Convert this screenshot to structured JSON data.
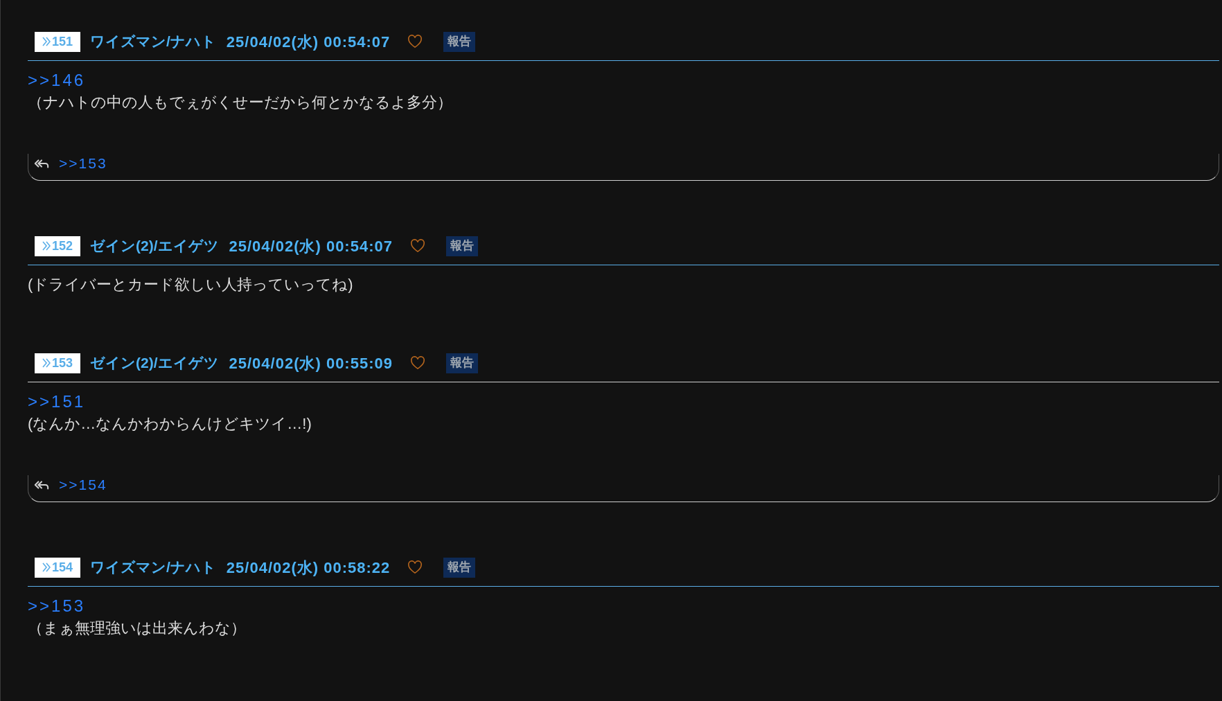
{
  "posts": [
    {
      "number": "151",
      "name": "ワイズマン/ナハト",
      "date": "25/04/02(水) 00:54:07",
      "report": "報告",
      "color": "#5aaee8",
      "anchor": ">>146",
      "body": "（ナハトの中の人もでぇがくせーだから何とかなるよ多分）",
      "replies": [
        ">>153"
      ]
    },
    {
      "number": "152",
      "name": "ゼイン(2)/エイゲツ",
      "date": "25/04/02(水) 00:54:07",
      "report": "報告",
      "color": "#5aaee8",
      "body": "(ドライバーとカード欲しい人持っていってね)"
    },
    {
      "number": "153",
      "name": "ゼイン(2)/エイゲツ",
      "date": "25/04/02(水) 00:55:09",
      "report": "報告",
      "color": "#d0d0d0",
      "anchor": ">>151",
      "body": "(なんか…なんかわからんけどキツイ…!)",
      "replies": [
        ">>154"
      ]
    },
    {
      "number": "154",
      "name": "ワイズマン/ナハト",
      "date": "25/04/02(水) 00:58:22",
      "report": "報告",
      "color": "#5aaee8",
      "anchor": ">>153",
      "body": "（まぁ無理強いは出来んわな）"
    }
  ]
}
